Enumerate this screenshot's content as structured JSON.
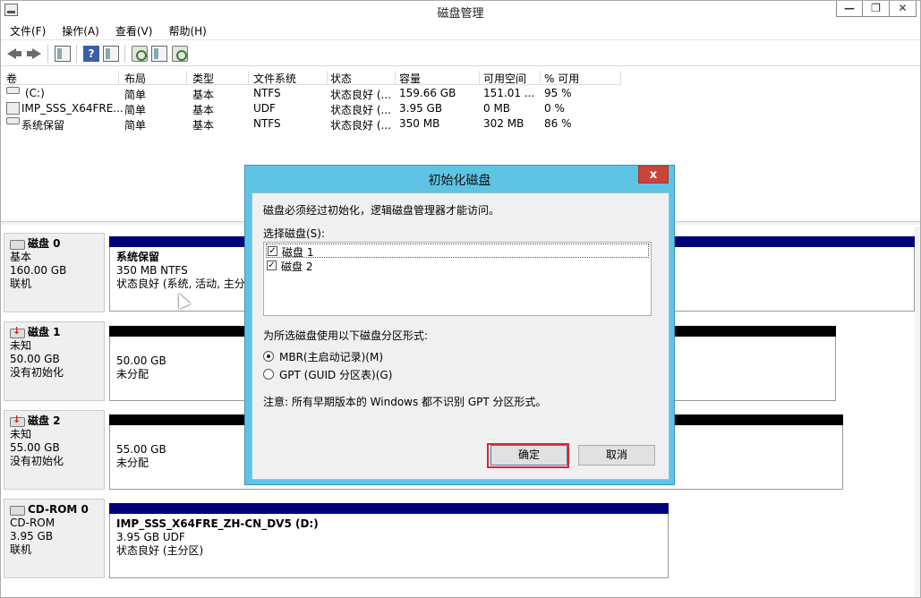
{
  "window": {
    "title": "磁盘管理",
    "min": "—",
    "restore": "❐",
    "close": "✕"
  },
  "menu": [
    "文件(F)",
    "操作(A)",
    "查看(V)",
    "帮助(H)"
  ],
  "toolbar": {
    "help_label": "?"
  },
  "volume_table": {
    "columns": [
      "卷",
      "布局",
      "类型",
      "文件系统",
      "状态",
      "容量",
      "可用空间",
      "% 可用"
    ],
    "rows": [
      {
        "volume": "(C:)",
        "layout": "简单",
        "type": "基本",
        "fs": "NTFS",
        "status": "状态良好 (...",
        "capacity": "159.66 GB",
        "free": "151.01 ...",
        "pct": "95 %",
        "icon": "drive-icon"
      },
      {
        "volume": "IMP_SSS_X64FRE...",
        "layout": "简单",
        "type": "基本",
        "fs": "UDF",
        "status": "状态良好 (...",
        "capacity": "3.95 GB",
        "free": "0 MB",
        "pct": "0 %",
        "icon": "cd-icon"
      },
      {
        "volume": "系统保留",
        "layout": "简单",
        "type": "基本",
        "fs": "NTFS",
        "status": "状态良好 (...",
        "capacity": "350 MB",
        "free": "302 MB",
        "pct": "86 %",
        "icon": "drive-icon"
      }
    ]
  },
  "disks": [
    {
      "name": "磁盘 0",
      "kind": "基本",
      "size": "160.00 GB",
      "state": "联机",
      "partition": {
        "title": "系统保留",
        "line1": "350 MB NTFS",
        "line2": "状态良好 (系统, 活动, 主分"
      }
    },
    {
      "name": "磁盘 1",
      "kind": "未知",
      "size": "50.00 GB",
      "state": "没有初始化",
      "partition": {
        "line1": "50.00 GB",
        "line2": "未分配"
      }
    },
    {
      "name": "磁盘 2",
      "kind": "未知",
      "size": "55.00 GB",
      "state": "没有初始化",
      "partition": {
        "line1": "55.00 GB",
        "line2": "未分配"
      }
    },
    {
      "name": "CD-ROM 0",
      "kind": "CD-ROM",
      "size": "3.95 GB",
      "state": "联机",
      "partition": {
        "title": "IMP_SSS_X64FRE_ZH-CN_DV5  (D:)",
        "line1": "3.95 GB UDF",
        "line2": "状态良好 (主分区)"
      }
    }
  ],
  "colors": {
    "primary_bar": "#00007b",
    "unallocated_bar": "#000000",
    "dialog_frame": "#5fc4e3",
    "highlight": "#e0232f"
  },
  "dialog": {
    "title": "初始化磁盘",
    "close": "x",
    "intro": "磁盘必须经过初始化，逻辑磁盘管理器才能访问。",
    "select_label": "选择磁盘(S):",
    "disks": [
      {
        "label": "磁盘 1",
        "checked": true
      },
      {
        "label": "磁盘 2",
        "checked": true
      }
    ],
    "style_label": "为所选磁盘使用以下磁盘分区形式:",
    "options": [
      {
        "label": "MBR(主启动记录)(M)",
        "selected": true
      },
      {
        "label": "GPT (GUID 分区表)(G)",
        "selected": false
      }
    ],
    "note": "注意: 所有早期版本的 Windows 都不识别 GPT 分区形式。",
    "ok": "确定",
    "cancel": "取消",
    "check_mark": "✓"
  }
}
